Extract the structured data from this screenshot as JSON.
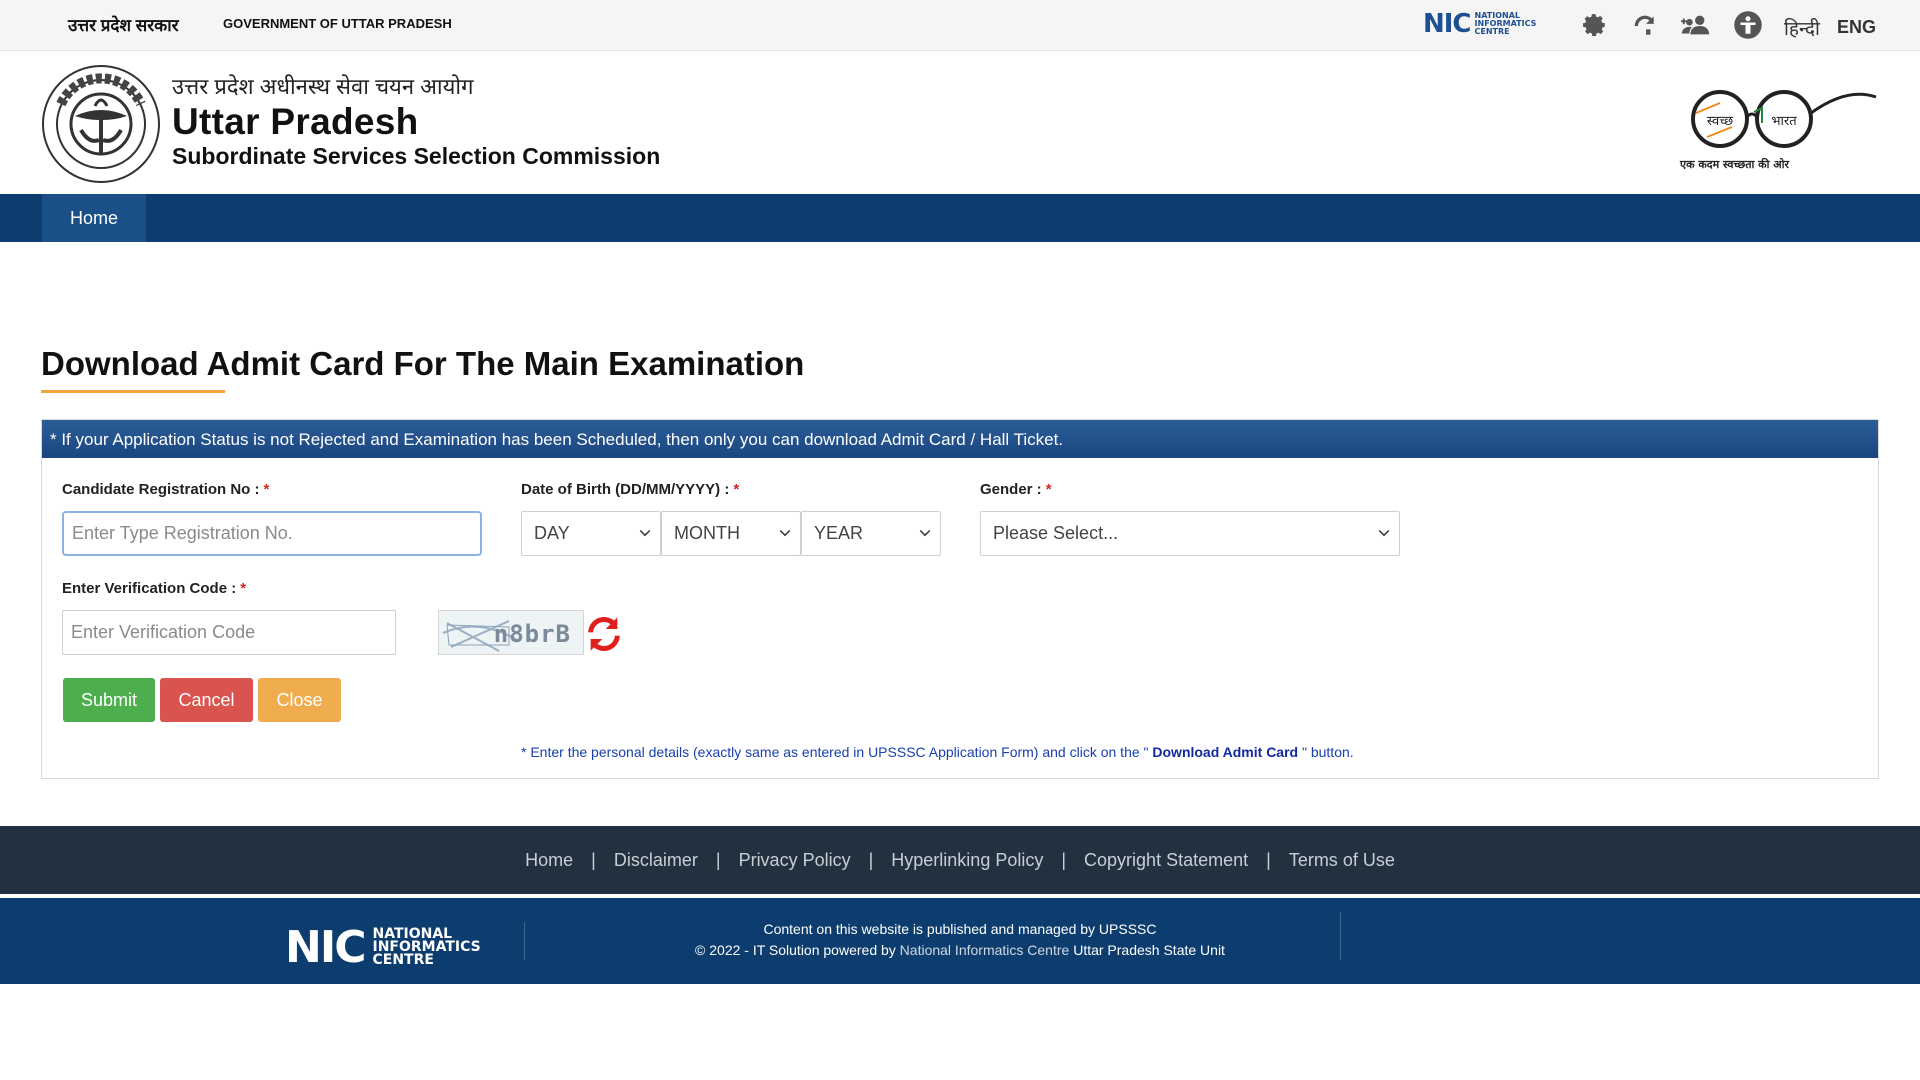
{
  "topbar": {
    "gov_hindi": "उत्तर प्रदेश सरकार",
    "gov_english": "GOVERNMENT OF UTTAR PRADESH",
    "nic_logo_text": "NIC",
    "nic_logo_words": "NATIONAL INFORMATICS CENTRE",
    "icons": [
      "gear-icon",
      "accessibility-icon",
      "users-icon",
      "sitemap-icon"
    ],
    "lang_hindi": "हिन्दी",
    "lang_english": "ENG"
  },
  "header": {
    "hindi_title": "उत्तर प्रदेश अधीनस्थ सेवा चयन आयोग",
    "title": "Uttar Pradesh",
    "subtitle": "Subordinate Services Selection Commission",
    "swachh_left": "स्वच्छ",
    "swachh_right": "भारत",
    "swachh_tagline": "एक कदम स्वच्छता की ओर"
  },
  "nav": {
    "items": [
      {
        "label": "Home",
        "active": true
      }
    ]
  },
  "page": {
    "title": "Download Admit Card For The Main Examination"
  },
  "form": {
    "notice": "* If your Application Status is not Rejected and Examination has been Scheduled, then only you can download Admit Card / Hall Ticket.",
    "registration_label": "Candidate Registration No :",
    "registration_placeholder": "Enter Type Registration No.",
    "dob_label": "Date of Birth (DD/MM/YYYY) :",
    "day_value": "DAY",
    "month_value": "MONTH",
    "year_value": "YEAR",
    "gender_label": "Gender :",
    "gender_value": "Please Select...",
    "verification_label": "Enter Verification Code :",
    "verification_placeholder": "Enter Verification Code",
    "captcha_text": "n8brB",
    "required_mark": "*",
    "submit_label": "Submit",
    "cancel_label": "Cancel",
    "close_label": "Close",
    "note_prefix": "* Enter the personal details (exactly same as entered in UPSSSC Application Form) and click on the \"",
    "note_link": "Download Admit Card",
    "note_suffix": "\" button."
  },
  "footer": {
    "links": [
      "Home",
      "Disclaimer",
      "Privacy Policy",
      "Hyperlinking Policy",
      "Copyright Statement",
      "Terms of Use"
    ],
    "separator": "|",
    "nic_mark": "NIC",
    "nic_words_1": "NATIONAL",
    "nic_words_2": "INFORMATICS",
    "nic_words_3": "CENTRE",
    "line1": "Content on this website is published and managed by UPSSSC",
    "line2_prefix": "© 2022 - IT Solution powered by",
    "line2_link": "National Informatics Centre",
    "line2_suffix": "Uttar Pradesh State Unit"
  },
  "colors": {
    "navbar": "#0d3d6e",
    "nav_active": "#1a4f88",
    "accent_underline": "#f0a43a",
    "submit": "#4cae4c",
    "cancel": "#d9534f",
    "close": "#f0ad4e",
    "required": "#d9251c",
    "refresh": "#e0201c",
    "footer_links_bg": "#22313f"
  }
}
